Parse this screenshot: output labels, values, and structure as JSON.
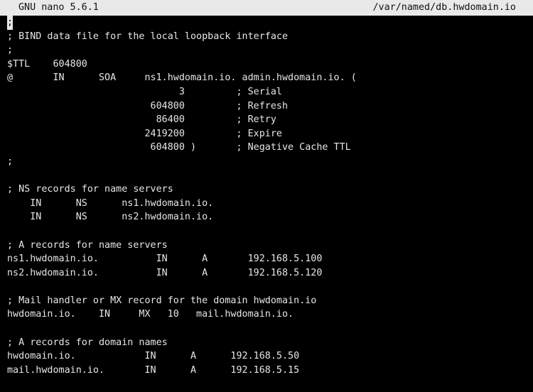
{
  "titlebar": {
    "app": "GNU nano 5.6.1",
    "file": "/var/named/db.hwdomain.io"
  },
  "editor": {
    "cursor_char": ";",
    "lines": [
      "; BIND data file for the local loopback interface",
      ";",
      "$TTL    604800",
      "@       IN      SOA     ns1.hwdomain.io. admin.hwdomain.io. (",
      "                              3         ; Serial",
      "                         604800         ; Refresh",
      "                          86400         ; Retry",
      "                        2419200         ; Expire",
      "                         604800 )       ; Negative Cache TTL",
      ";",
      "",
      "; NS records for name servers",
      "    IN      NS      ns1.hwdomain.io.",
      "    IN      NS      ns2.hwdomain.io.",
      "",
      "; A records for name servers",
      "ns1.hwdomain.io.          IN      A       192.168.5.100",
      "ns2.hwdomain.io.          IN      A       192.168.5.120",
      "",
      "; Mail handler or MX record for the domain hwdomain.io",
      "hwdomain.io.    IN     MX   10   mail.hwdomain.io.",
      "",
      "; A records for domain names",
      "hwdomain.io.            IN      A      192.168.5.50",
      "mail.hwdomain.io.       IN      A      192.168.5.15"
    ]
  }
}
